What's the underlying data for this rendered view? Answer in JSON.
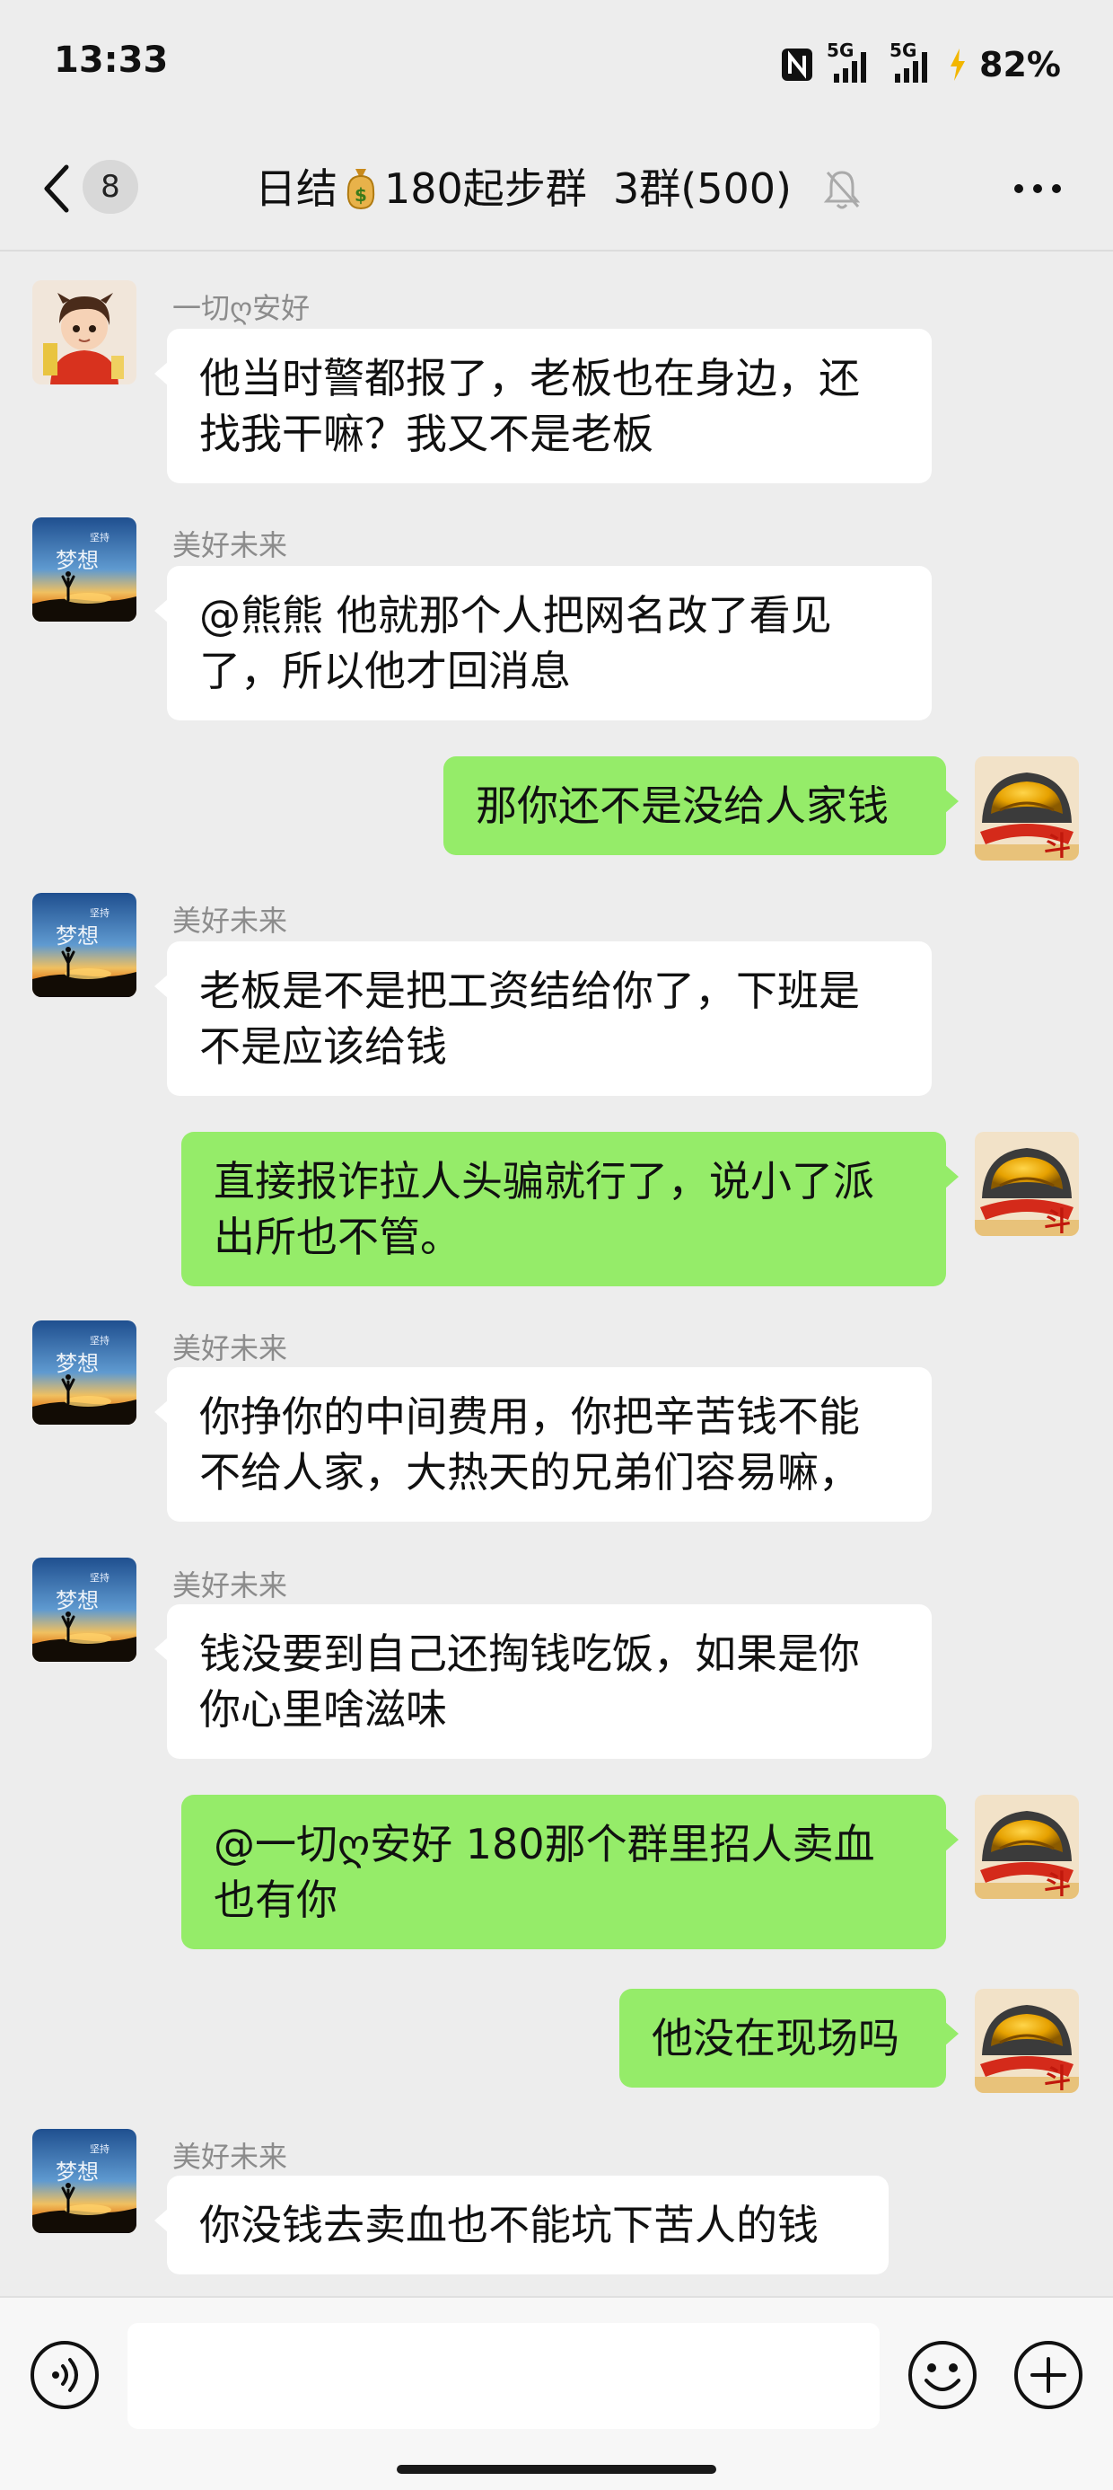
{
  "status_bar": {
    "time": "13:33",
    "network_1": "5G",
    "network_2": "5G",
    "battery": "82%",
    "icons": [
      "nfc-icon",
      "signal-icon",
      "signal-icon",
      "charging-icon"
    ]
  },
  "header": {
    "unread_count": "8",
    "title_prefix": "日结",
    "title_suffix": "180起步群  3群(500)",
    "icons": [
      "back-chevron-icon",
      "money-bag-icon",
      "mute-bell-icon",
      "more-icon"
    ]
  },
  "messages": [
    {
      "side": "in",
      "sender": "一切ღ安好",
      "lines": [
        "他当时警都报了，老板也在身边，还",
        "找我干嘛？我又不是老板"
      ]
    },
    {
      "side": "in",
      "sender": "美好未来",
      "lines": [
        "@熊熊  他就那个人把网名改了看见",
        "了，所以他才回消息"
      ]
    },
    {
      "side": "out",
      "lines": [
        "那你还不是没给人家钱"
      ]
    },
    {
      "side": "in",
      "sender": "美好未来",
      "lines": [
        "老板是不是把工资结给你了，下班是",
        "不是应该给钱"
      ]
    },
    {
      "side": "out",
      "lines": [
        "直接报诈拉人头骗就行了，说小了派",
        "出所也不管。"
      ]
    },
    {
      "side": "in",
      "sender": "美好未来",
      "lines": [
        "你挣你的中间费用，你把辛苦钱不能",
        "不给人家，大热天的兄弟们容易嘛，"
      ]
    },
    {
      "side": "in",
      "sender": "美好未来",
      "lines": [
        "钱没要到自己还掏钱吃饭，如果是你",
        "你心里啥滋味"
      ]
    },
    {
      "side": "out",
      "lines": [
        "@一切ღ安好 180那个群里招人卖血",
        "也有你"
      ]
    },
    {
      "side": "out",
      "lines": [
        "他没在现场吗"
      ]
    },
    {
      "side": "in",
      "sender": "美好未来",
      "lines": [
        "你没钱去卖血也不能坑下苦人的钱"
      ]
    }
  ],
  "avatar_text": {
    "dream_top": "坚持",
    "dream_main": "梦想",
    "mascot_char": "斗"
  },
  "input_bar": {
    "placeholder": "",
    "icons": [
      "voice-icon",
      "emoji-icon",
      "plus-icon"
    ]
  },
  "colors": {
    "background": "#ededed",
    "outgoing_bubble": "#95ec69",
    "incoming_bubble": "#ffffff",
    "sender_name": "#8c8c8c"
  }
}
